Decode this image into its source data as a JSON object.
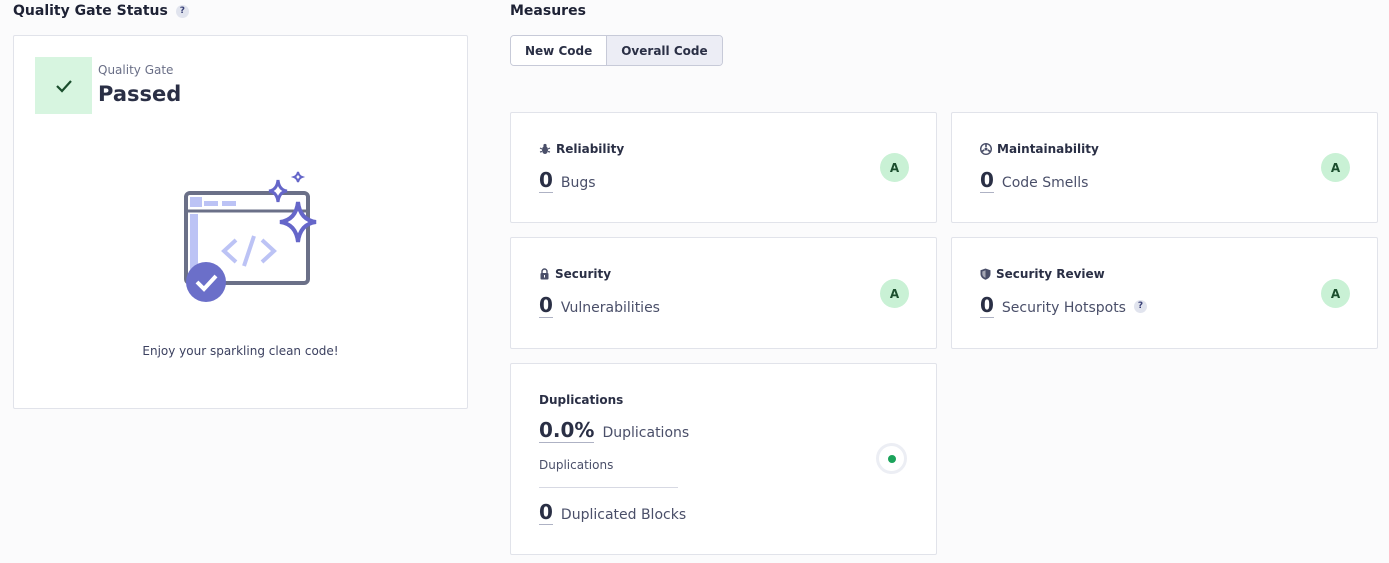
{
  "quality_gate": {
    "section_title": "Quality Gate Status",
    "help": "?",
    "label": "Quality Gate",
    "status": "Passed",
    "message": "Enjoy your sparkling clean code!",
    "status_color": "#d7f5e0"
  },
  "measures": {
    "section_title": "Measures",
    "tabs": [
      {
        "label": "New Code",
        "active": false
      },
      {
        "label": "Overall Code",
        "active": true
      }
    ],
    "cards": {
      "reliability": {
        "title": "Reliability",
        "icon": "bug-icon",
        "value": "0",
        "metric": "Bugs",
        "rating": "A"
      },
      "maintainability": {
        "title": "Maintainability",
        "icon": "maintainability-icon",
        "value": "0",
        "metric": "Code Smells",
        "rating": "A"
      },
      "security": {
        "title": "Security",
        "icon": "lock-icon",
        "value": "0",
        "metric": "Vulnerabilities",
        "rating": "A"
      },
      "security_review": {
        "title": "Security Review",
        "icon": "shield-icon",
        "value": "0",
        "metric": "Security Hotspots",
        "help": "?",
        "rating": "A"
      },
      "duplications": {
        "title": "Duplications",
        "value": "0.0%",
        "metric": "Duplications",
        "sub_label": "Duplications",
        "blocks_value": "0",
        "blocks_metric": "Duplicated Blocks"
      }
    },
    "rating_color": "#c9f1d5",
    "accent_color": "#1ba35b"
  }
}
